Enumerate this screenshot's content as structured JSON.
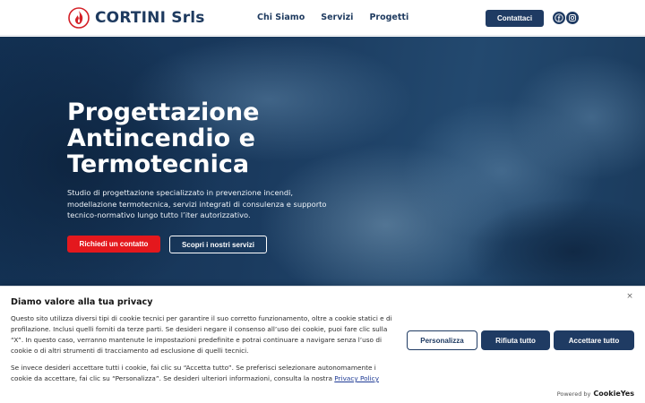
{
  "header": {
    "logo_text": "CORTINI Srls",
    "nav": [
      "Chi Siamo",
      "Servizi",
      "Progetti"
    ],
    "contact_label": "Contattaci",
    "social": [
      "facebook-icon",
      "instagram-icon"
    ]
  },
  "hero": {
    "title_lines": [
      "Progettazione",
      "Antincendio e",
      "Termotecnica"
    ],
    "description": "Studio di progettazione specializzato in prevenzione incendi, modellazione termotecnica, servizi integrati di consulenza e supporto tecnico-normativo lungo tutto l’iter autorizzativo.",
    "primary_cta": "Richiedi un contatto",
    "secondary_cta": "Scopri i nostri servizi"
  },
  "cookie_banner": {
    "title": "Diamo valore alla tua privacy",
    "paragraph1": "Questo sito utilizza diversi tipi di cookie tecnici per garantire il suo corretto funzionamento, oltre a cookie statici e di profilazione. Inclusi quelli forniti da terze parti. Se desideri negare il consenso all’uso dei cookie, puoi fare clic sulla “X”. In questo caso, verranno mantenute le impostazioni predefinite e potrai continuare a navigare senza l’uso di cookie o di altri strumenti di tracciamento ad esclusione di quelli tecnici.",
    "paragraph2": "Se invece desideri accettare tutti i cookie, fai clic su “Accetta tutto”. Se preferisci selezionare autonomamente i cookie da accettare, fai clic su “Personalizza”. Se desideri ulteriori informazioni, consulta la nostra Privacy Policy.",
    "privacy_link": "Privacy Policy",
    "close_label": "×",
    "buttons": {
      "customize": "Personalizza",
      "reject": "Rifiuta tutto",
      "accept": "Accettare tutto"
    },
    "powered_by": "Powered by",
    "powered_brand": "CookieYes"
  },
  "colors": {
    "brand_navy": "#1f3b63",
    "cta_red": "#e4181d",
    "hero_bg": "#1a3a5e"
  }
}
